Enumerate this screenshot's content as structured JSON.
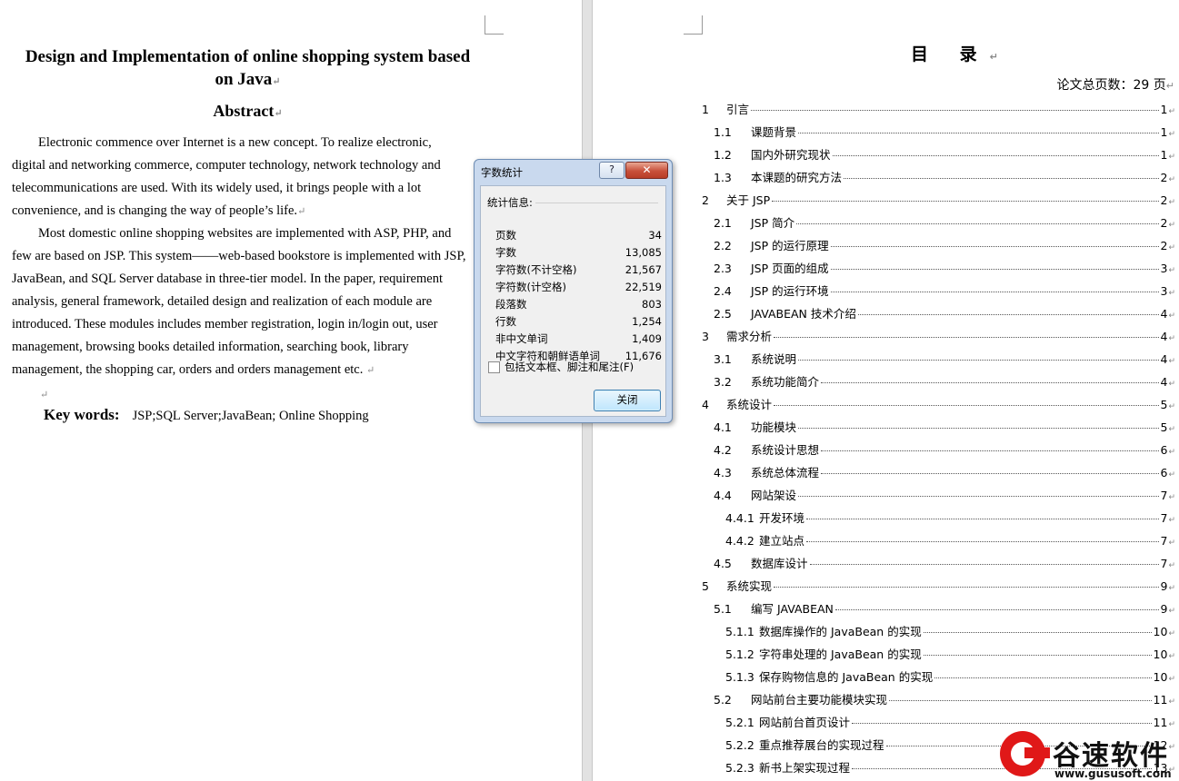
{
  "left_page": {
    "title_line1": "Design and Implementation of online shopping system based",
    "title_line2": "on Java",
    "abstract_heading": "Abstract",
    "para1": [
      "Electronic commence over Internet is a new concept. To realize electronic,",
      "digital and networking commerce, computer technology, network technology and",
      "telecommunications are used. With its widely used, it brings people with a lot",
      "convenience, and is changing the way of people’s life."
    ],
    "para2": [
      "Most domestic online shopping websites are implemented with ASP, PHP, and",
      "few are based on JSP. This system——web-based bookstore is implemented with JSP,",
      "JavaBean, and SQL Server database in three-tier model. In the paper, requirement",
      "analysis, general framework, detailed design and realization of each module are",
      "introduced. These modules includes member registration, login in/login out, user",
      "management, browsing books detailed information, searching book, library",
      "management, the shopping car, orders and orders management etc."
    ],
    "keywords_label": "Key  words:",
    "keywords_text": "JSP;SQL Server;JavaBean; Online Shopping"
  },
  "dialog": {
    "title": "字数统计",
    "help_label": "?",
    "close_x": "✕",
    "section_label": "统计信息:",
    "stats": [
      {
        "label": "页数",
        "value": "34"
      },
      {
        "label": "字数",
        "value": "13,085"
      },
      {
        "label": "字符数(不计空格)",
        "value": "21,567"
      },
      {
        "label": "字符数(计空格)",
        "value": "22,519"
      },
      {
        "label": "段落数",
        "value": "803"
      },
      {
        "label": "行数",
        "value": "1,254"
      },
      {
        "label": "非中文单词",
        "value": "1,409"
      },
      {
        "label": "中文字符和朝鲜语单词",
        "value": "11,676"
      }
    ],
    "checkbox_label": "包括文本框、脚注和尾注(F)",
    "close_button": "关闭"
  },
  "right_page": {
    "toc_title": "目 录",
    "total_pages": "论文总页数：29 页",
    "toc": [
      {
        "num": "1",
        "label": "引言",
        "page": "1",
        "level": 1
      },
      {
        "num": "1.1",
        "label": "课题背景",
        "page": "1",
        "level": 2
      },
      {
        "num": "1.2",
        "label": "国内外研究现状",
        "page": "1",
        "level": 2
      },
      {
        "num": "1.3",
        "label": "本课题的研究方法",
        "page": "2",
        "level": 2
      },
      {
        "num": "2",
        "label": "关于 JSP",
        "page": "2",
        "level": 1
      },
      {
        "num": "2.1",
        "label": "JSP 简介",
        "page": "2",
        "level": 2
      },
      {
        "num": "2.2",
        "label": "JSP 的运行原理",
        "page": "2",
        "level": 2
      },
      {
        "num": "2.3",
        "label": "JSP 页面的组成",
        "page": "3",
        "level": 2
      },
      {
        "num": "2.4",
        "label": "JSP 的运行环境",
        "page": "3",
        "level": 2
      },
      {
        "num": "2.5",
        "label": "JAVABEAN 技术介绍",
        "page": "4",
        "level": 2
      },
      {
        "num": "3",
        "label": "需求分析",
        "page": "4",
        "level": 1
      },
      {
        "num": "3.1",
        "label": "系统说明",
        "page": "4",
        "level": 2
      },
      {
        "num": "3.2",
        "label": "系统功能简介",
        "page": "4",
        "level": 2
      },
      {
        "num": "4",
        "label": "系统设计",
        "page": "5",
        "level": 1
      },
      {
        "num": "4.1",
        "label": "功能模块",
        "page": "5",
        "level": 2
      },
      {
        "num": "4.2",
        "label": "系统设计思想",
        "page": "6",
        "level": 2
      },
      {
        "num": "4.3",
        "label": "系统总体流程",
        "page": "6",
        "level": 2
      },
      {
        "num": "4.4",
        "label": "网站架设",
        "page": "7",
        "level": 2
      },
      {
        "num": "4.4.1",
        "label": "开发环境",
        "page": "7",
        "level": 3
      },
      {
        "num": "4.4.2",
        "label": "建立站点",
        "page": "7",
        "level": 3
      },
      {
        "num": "4.5",
        "label": "数据库设计",
        "page": "7",
        "level": 2
      },
      {
        "num": "5",
        "label": "系统实现",
        "page": "9",
        "level": 1
      },
      {
        "num": "5.1",
        "label": "编写 JAVABEAN",
        "page": "9",
        "level": 2
      },
      {
        "num": "5.1.1",
        "label": "数据库操作的 JavaBean 的实现",
        "page": "10",
        "level": 3
      },
      {
        "num": "5.1.2",
        "label": "字符串处理的 JavaBean 的实现",
        "page": "10",
        "level": 3
      },
      {
        "num": "5.1.3",
        "label": "保存购物信息的 JavaBean 的实现",
        "page": "10",
        "level": 3
      },
      {
        "num": "5.2",
        "label": "网站前台主要功能模块实现",
        "page": "11",
        "level": 2
      },
      {
        "num": "5.2.1",
        "label": "网站前台首页设计",
        "page": "11",
        "level": 3
      },
      {
        "num": "5.2.2",
        "label": "重点推荐展台的实现过程",
        "page": "12",
        "level": 3
      },
      {
        "num": "5.2.3",
        "label": "新书上架实现过程",
        "page": "13",
        "level": 3
      }
    ]
  },
  "watermark": {
    "name": "谷速软件",
    "url": "www.gususoft.com"
  }
}
